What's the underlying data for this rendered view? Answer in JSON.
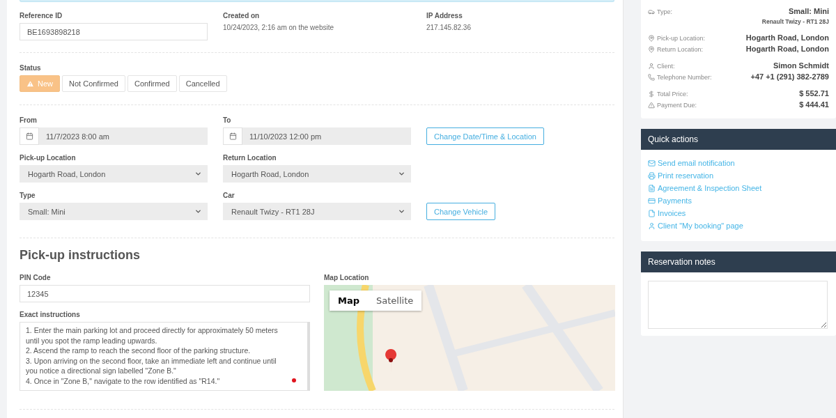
{
  "reference": {
    "label": "Reference ID",
    "value": "BE1693898218"
  },
  "created": {
    "label": "Created on",
    "value": "10/24/2023, 2:16 am on the website"
  },
  "ip": {
    "label": "IP Address",
    "value": "217.145.82.36"
  },
  "status": {
    "label": "Status",
    "options": [
      {
        "label": "New",
        "selected": true
      },
      {
        "label": "Not Confirmed",
        "selected": false
      },
      {
        "label": "Confirmed",
        "selected": false
      },
      {
        "label": "Cancelled",
        "selected": false
      }
    ]
  },
  "dates": {
    "from": {
      "label": "From",
      "value": "11/7/2023 8:00 am"
    },
    "to": {
      "label": "To",
      "value": "11/10/2023 12:00 pm"
    },
    "button": "Change Date/Time & Location"
  },
  "locations": {
    "pickup": {
      "label": "Pick-up Location",
      "value": "Hogarth Road, London"
    },
    "return": {
      "label": "Return Location",
      "value": "Hogarth Road, London"
    }
  },
  "vehicle": {
    "type": {
      "label": "Type",
      "value": "Small: Mini"
    },
    "car": {
      "label": "Car",
      "value": "Renault Twizy - RT1 28J"
    },
    "button": "Change Vehicle"
  },
  "pickup_instructions": {
    "title": "Pick-up instructions",
    "pin": {
      "label": "PIN Code",
      "value": "12345"
    },
    "instructions": {
      "label": "Exact instructions",
      "lines": [
        "1. Enter the main parking lot and proceed directly for approximately 50 meters until you spot the ramp leading upwards.",
        "2. Ascend the ramp to reach the second floor of the parking structure.",
        "3. Upon arriving on the second floor, take an immediate left and continue until you notice a directional sign labelled \"Zone B.\"",
        "4. Once in \"Zone B,\" navigate to the row identified as \"R14.\""
      ]
    },
    "map": {
      "label": "Map Location",
      "modes": [
        {
          "label": "Map",
          "selected": true
        },
        {
          "label": "Satellite",
          "selected": false
        }
      ]
    }
  },
  "summary": {
    "groups": [
      [
        {
          "kind": "car",
          "label": "Type:",
          "value": "Small: Mini",
          "detail": "Renault Twizy - RT1 28J"
        }
      ],
      [
        {
          "kind": "pin",
          "label": "Pick-up Location:",
          "value": "Hogarth Road, London"
        },
        {
          "kind": "pin",
          "label": "Return Location:",
          "value": "Hogarth Road, London"
        }
      ],
      [
        {
          "kind": "user",
          "label": "Client:",
          "value": "Simon Schmidt"
        },
        {
          "kind": "phone",
          "label": "Telephone Number:",
          "value": "+47 +1 (291) 382-2789"
        }
      ],
      [
        {
          "kind": "dollar",
          "label": "Total Price:",
          "value": "$ 552.71"
        },
        {
          "kind": "warning",
          "label": "Payment Due:",
          "value": "$ 444.41"
        }
      ]
    ]
  },
  "quick_actions": {
    "title": "Quick actions",
    "items": [
      {
        "kind": "email",
        "label": "Send email notification"
      },
      {
        "kind": "print",
        "label": "Print reservation"
      },
      {
        "kind": "document",
        "label": "Agreement & Inspection Sheet"
      },
      {
        "kind": "card",
        "label": "Payments"
      },
      {
        "kind": "invoice",
        "label": "Invoices"
      },
      {
        "kind": "user",
        "label": "Client \"My booking\" page"
      }
    ]
  },
  "notes": {
    "title": "Reservation notes"
  }
}
